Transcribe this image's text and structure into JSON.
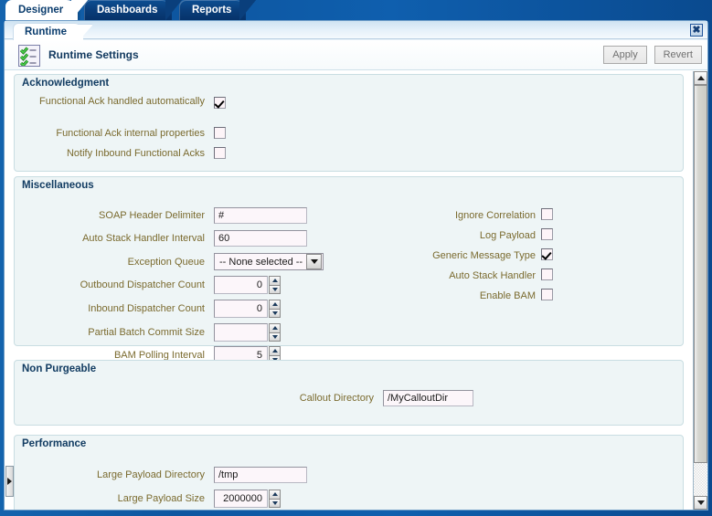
{
  "window": {
    "close_label": "✖"
  },
  "top_tabs": [
    {
      "label": "Designer",
      "active": true
    },
    {
      "label": "Dashboards",
      "active": false
    },
    {
      "label": "Reports",
      "active": false
    }
  ],
  "sub_tabs": [
    {
      "label": "Runtime",
      "active": true
    }
  ],
  "header": {
    "title": "Runtime Settings",
    "icon": "checklist-icon",
    "apply_label": "Apply",
    "revert_label": "Revert"
  },
  "sections": [
    {
      "title": "Acknowledgment",
      "fields": [
        {
          "label": "Functional Ack handled automatically",
          "type": "checkbox",
          "checked": true
        },
        {
          "label": "Functional Ack internal properties",
          "type": "checkbox",
          "checked": false
        },
        {
          "label": "Notify Inbound Functional Acks",
          "type": "checkbox",
          "checked": false
        }
      ]
    },
    {
      "title": "Miscellaneous",
      "fields_left": [
        {
          "label": "SOAP Header Delimiter",
          "type": "text",
          "value": "#"
        },
        {
          "label": "Auto Stack Handler Interval",
          "type": "text",
          "value": "60"
        },
        {
          "label": "Exception Queue",
          "type": "select",
          "value": "-- None selected --"
        },
        {
          "label": "Outbound Dispatcher Count",
          "type": "spinner",
          "value": "0"
        },
        {
          "label": "Inbound Dispatcher Count",
          "type": "spinner",
          "value": "0"
        },
        {
          "label": "Partial Batch Commit Size",
          "type": "spinner",
          "value": ""
        },
        {
          "label": "BAM Polling Interval",
          "type": "spinner",
          "value": "5"
        }
      ],
      "fields_right": [
        {
          "label": "Ignore Correlation",
          "type": "checkbox",
          "checked": false
        },
        {
          "label": "Log Payload",
          "type": "checkbox",
          "checked": false
        },
        {
          "label": "Generic Message Type",
          "type": "checkbox",
          "checked": true
        },
        {
          "label": "Auto Stack Handler",
          "type": "checkbox",
          "checked": false
        },
        {
          "label": "Enable BAM",
          "type": "checkbox",
          "checked": false
        }
      ]
    },
    {
      "title": "Non Purgeable",
      "fields": [
        {
          "label": "Callout Directory",
          "type": "text",
          "value": "/MyCalloutDir"
        }
      ]
    },
    {
      "title": "Performance",
      "fields": [
        {
          "label": "Large Payload Directory",
          "type": "text",
          "value": "/tmp"
        },
        {
          "label": "Large Payload Size",
          "type": "spinner",
          "value": "2000000"
        }
      ]
    }
  ],
  "colors": {
    "window_chrome": "#0d56a0",
    "panel_bg": "#eef5f6",
    "section_title": "#123c62",
    "field_label": "#7a6a2e",
    "input_bg": "#fcf6fa",
    "accent_green": "#33aa33"
  },
  "scrollbar": {
    "up_icon": "triangle-up-icon",
    "down_icon": "triangle-down-icon"
  }
}
